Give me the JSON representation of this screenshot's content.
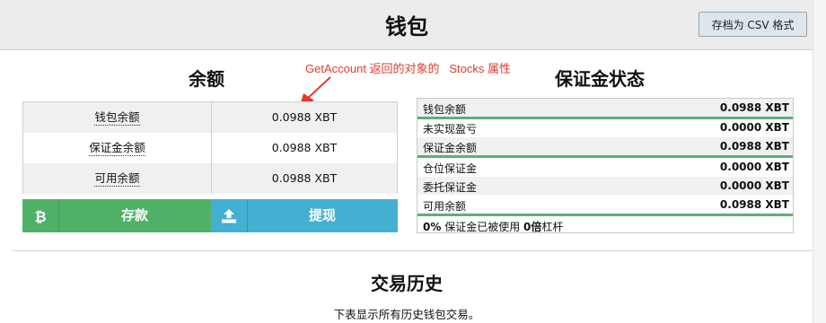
{
  "header": {
    "title": "钱包",
    "export_button": "存档为 CSV 格式"
  },
  "balance": {
    "title": "余额",
    "rows": [
      {
        "label": "钱包余额",
        "value": "0.0988 XBT"
      },
      {
        "label": "保证金余额",
        "value": "0.0988 XBT"
      },
      {
        "label": "可用余额",
        "value": "0.0988 XBT"
      }
    ],
    "deposit_label": "存款",
    "withdraw_label": "提现"
  },
  "annotation": {
    "text": "GetAccount 返回的对象的   Stocks 属性",
    "color": "#e23b2a"
  },
  "margin_status": {
    "title": "保证金状态",
    "rows": [
      {
        "label": "钱包余额",
        "value": "0.0988 XBT"
      },
      {
        "label": "未实现盈亏",
        "value": "0.0000 XBT"
      },
      {
        "label": "保证金余额",
        "value": "0.0988 XBT"
      },
      {
        "label": "仓位保证金",
        "value": "0.0000 XBT"
      },
      {
        "label": "委托保证金",
        "value": "0.0000 XBT"
      },
      {
        "label": "可用余额",
        "value": "0.0988 XBT"
      }
    ],
    "footer": {
      "pct": "0%",
      "used_text": "保证金已被使用",
      "leverage": "0倍",
      "leverage_text": "杠杆"
    }
  },
  "history": {
    "title": "交易历史",
    "subtitle": "下表显示所有历史钱包交易。"
  },
  "colors": {
    "deposit": "#4fb168",
    "withdraw": "#44b0d1",
    "separator": "#5bb07a"
  },
  "icons": {
    "deposit": "bitcoin-icon",
    "withdraw": "upload-icon"
  }
}
